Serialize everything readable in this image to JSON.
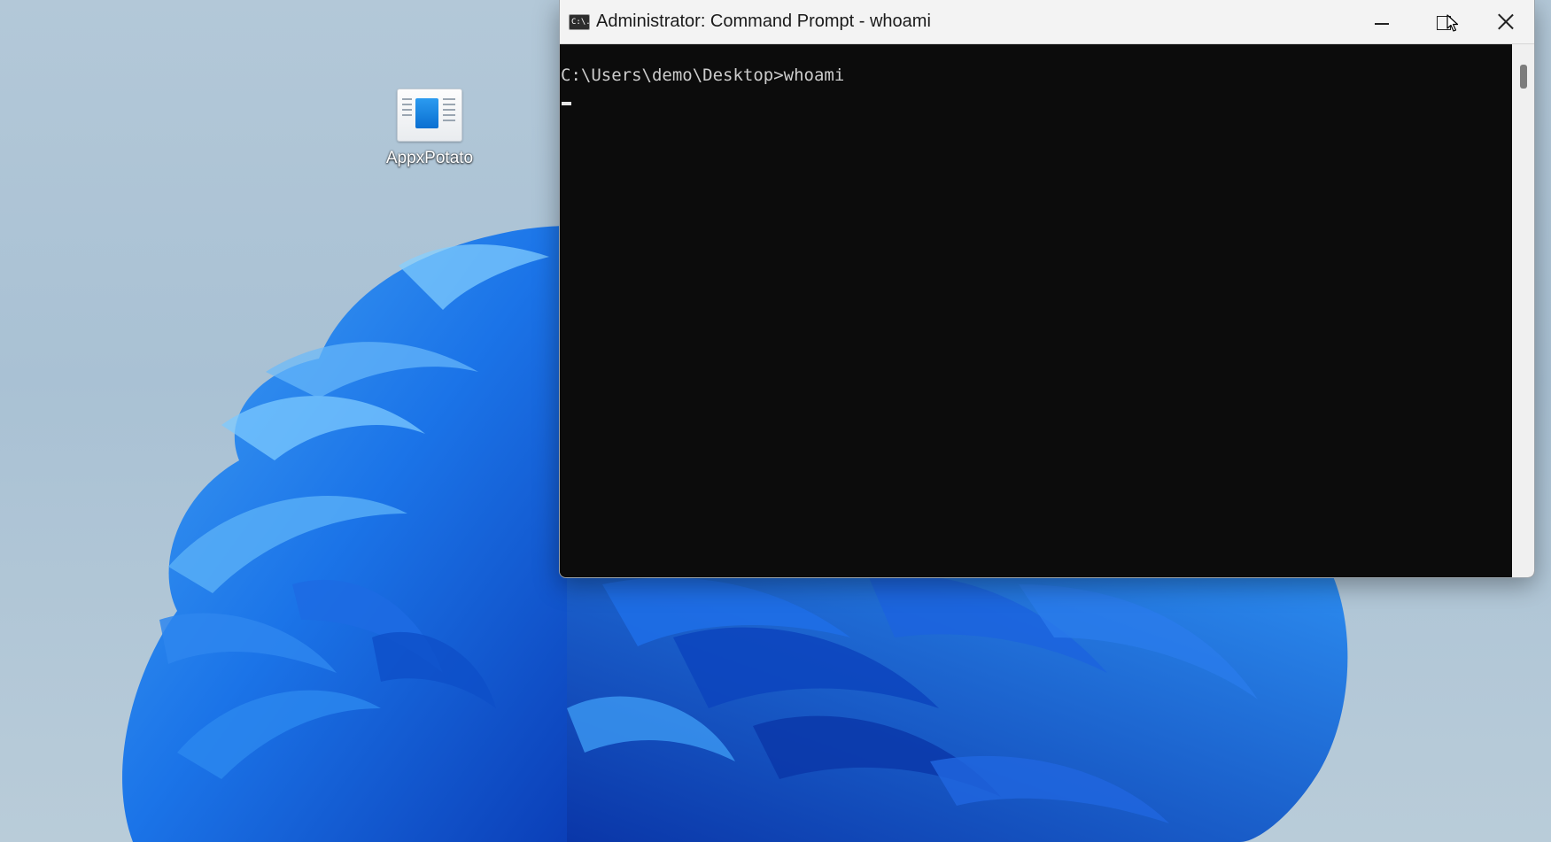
{
  "desktop": {
    "icons": [
      {
        "label": "AppxPotato"
      }
    ]
  },
  "window": {
    "title": "Administrator: Command Prompt - whoami",
    "icon_text": "C:\\.",
    "console": {
      "lines": [
        "C:\\Users\\demo\\Desktop>whoami"
      ]
    },
    "controls": [
      "minimize",
      "maximize",
      "close"
    ]
  },
  "colors": {
    "console_bg": "#0c0c0c",
    "console_text": "#cccccc",
    "titlebar_bg": "#f3f3f3",
    "wallpaper_blue": "#1a6fe6"
  }
}
